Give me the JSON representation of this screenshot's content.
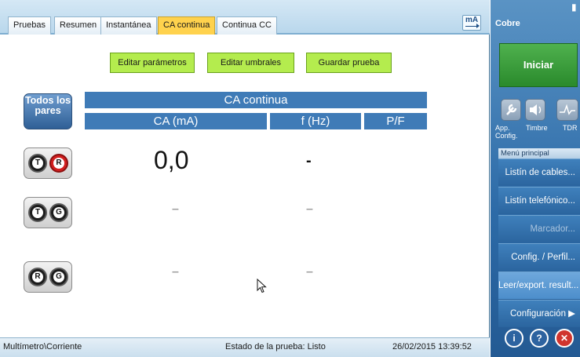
{
  "tabs": [
    {
      "label": "Pruebas",
      "active": false
    },
    {
      "label": "Resumen",
      "active": false
    },
    {
      "label": "Instantánea",
      "active": false
    },
    {
      "label": "CA continua",
      "active": true
    },
    {
      "label": "Continua CC",
      "active": false
    }
  ],
  "unit_icon": {
    "label": "mA",
    "icon": "ammeter-icon"
  },
  "actions": {
    "edit_params": "Editar parámetros",
    "edit_thresholds": "Editar umbrales",
    "save_test": "Guardar prueba"
  },
  "table": {
    "title": "CA continua",
    "all_pairs_label": "Todos los pares",
    "columns": [
      "CA (mA)",
      "f (Hz)",
      "P/F"
    ],
    "rows": [
      {
        "pair": [
          "T",
          "R"
        ],
        "ca": "0,0",
        "f": "-",
        "pf": ""
      },
      {
        "pair": [
          "T",
          "G"
        ],
        "ca": "–",
        "f": "–",
        "pf": ""
      },
      {
        "pair": [
          "R",
          "G"
        ],
        "ca": "–",
        "f": "–",
        "pf": ""
      }
    ]
  },
  "status": {
    "path": "Multímetro\\Corriente",
    "state": "Estado de la prueba: Listo",
    "datetime": "26/02/2015 13:39:52"
  },
  "side": {
    "title": "Cobre",
    "start": "Iniciar",
    "icons": [
      {
        "label": "App. Config.",
        "icon": "wrench-icon"
      },
      {
        "label": "Timbre",
        "icon": "speaker-icon"
      },
      {
        "label": "TDR",
        "icon": "tdr-waveform-icon"
      }
    ],
    "menu_label": "Menú principal",
    "menu": [
      {
        "label": "Listín de cables...",
        "disabled": false
      },
      {
        "label": "Listín telefónico...",
        "disabled": false
      },
      {
        "label": "Marcador...",
        "disabled": true
      },
      {
        "label": "Config. / Perfil...",
        "disabled": false
      },
      {
        "label": "Leer/export. result...",
        "disabled": false
      },
      {
        "label": "Configuración ▶",
        "disabled": false
      }
    ],
    "bottom_buttons": [
      "info-icon",
      "help-icon",
      "close-icon"
    ]
  },
  "colors": {
    "accent": "#3f7bb7",
    "active_tab": "#ffd24d",
    "action_green": "#b4ec4e",
    "start_green": "#2a8a2c",
    "pair_red": "#d21f1f"
  }
}
